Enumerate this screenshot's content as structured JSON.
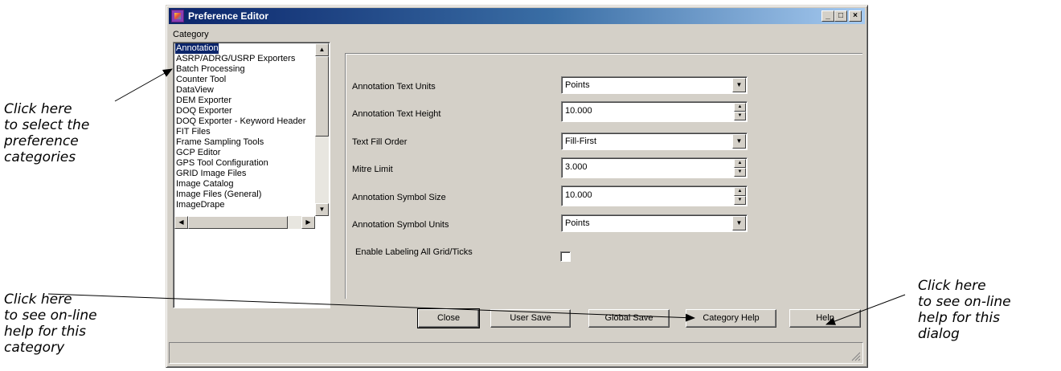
{
  "dialog": {
    "title": "Preference Editor",
    "window_buttons": {
      "minimize": "_",
      "maximize": "□",
      "close": "×"
    },
    "category_label": "Category",
    "categories": [
      "Annotation",
      "ASRP/ADRG/USRP Exporters",
      "Batch Processing",
      "Counter Tool",
      "DataView",
      "DEM Exporter",
      "DOQ Exporter",
      "DOQ Exporter - Keyword Header",
      "FIT Files",
      "Frame Sampling Tools",
      "GCP Editor",
      "GPS Tool Configuration",
      "GRID Image Files",
      "Image Catalog",
      "Image Files (General)",
      "ImageDrape"
    ],
    "selected_category": "Annotation",
    "fields": {
      "text_units": {
        "label": "Annotation Text Units",
        "value": "Points"
      },
      "text_height": {
        "label": "Annotation Text Height",
        "value": "10.000"
      },
      "fill_order": {
        "label": "Text Fill Order",
        "value": "Fill-First"
      },
      "mitre_limit": {
        "label": "Mitre Limit",
        "value": "3.000"
      },
      "symbol_size": {
        "label": "Annotation Symbol Size",
        "value": "10.000"
      },
      "symbol_units": {
        "label": "Annotation Symbol Units",
        "value": "Points"
      },
      "labeling": {
        "label": "Enable Labeling All Grid/Ticks",
        "checked": false
      }
    },
    "buttons": {
      "close": "Close",
      "user_save": "User Save",
      "global_save": "Global Save",
      "category_help": "Category Help",
      "help": "Help"
    }
  },
  "callouts": {
    "categories": [
      "Click here",
      "to select the",
      "preference",
      "categories"
    ],
    "category_help": [
      "Click here",
      "to see on-line",
      "help for this",
      "category"
    ],
    "dialog_help": [
      "Click here",
      "to see on-line",
      "help for this",
      "dialog"
    ]
  }
}
